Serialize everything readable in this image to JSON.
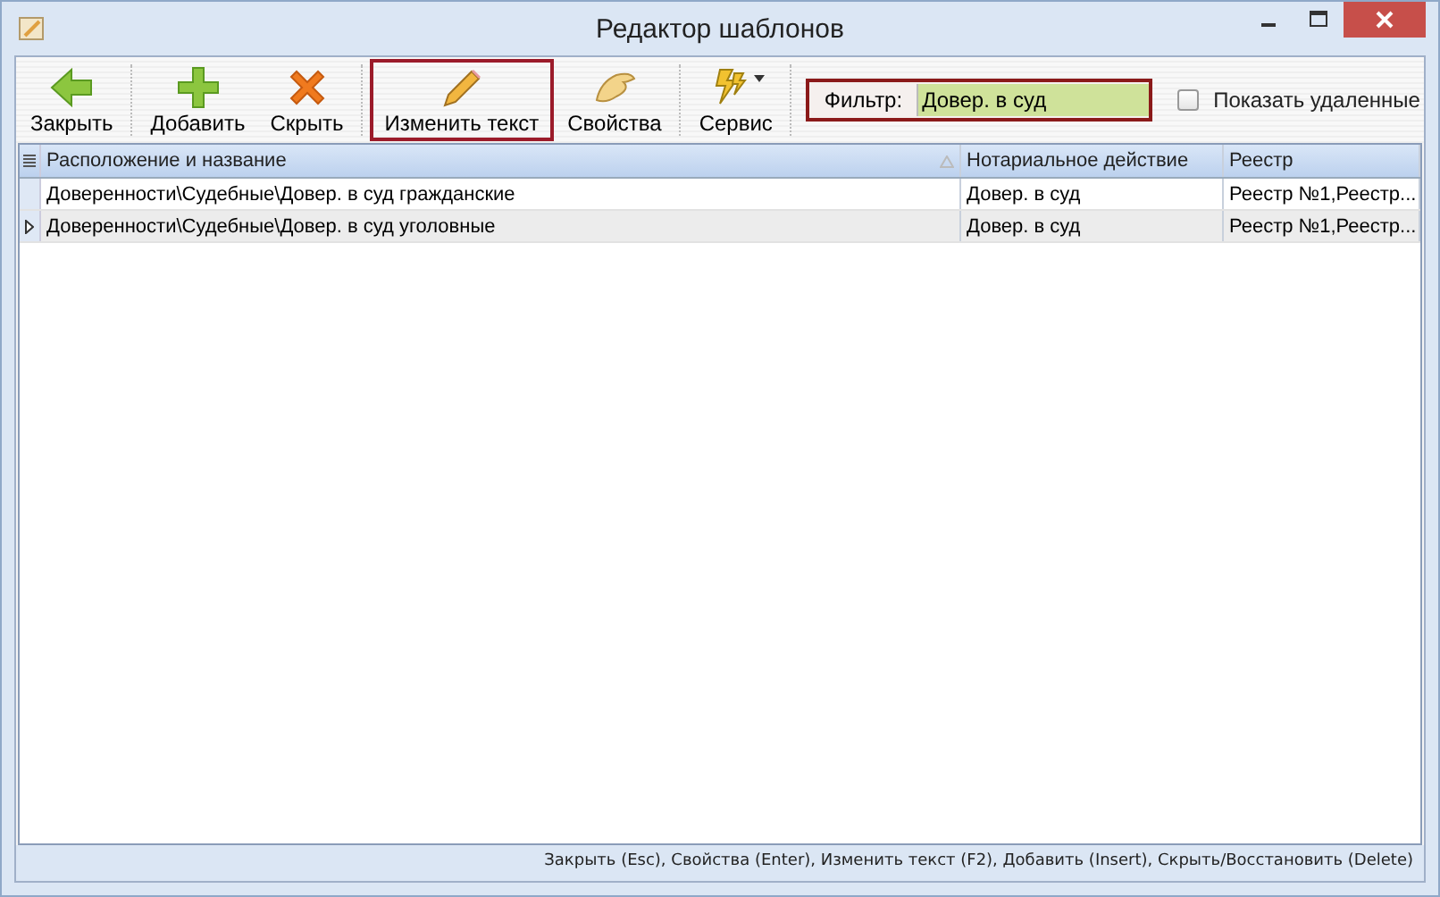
{
  "window": {
    "title": "Редактор шаблонов"
  },
  "toolbar": [
    {
      "kind": "back",
      "label": "Закрыть",
      "highlighted": false
    },
    {
      "kind": "add",
      "label": "Добавить",
      "highlighted": false
    },
    {
      "kind": "hide",
      "label": "Скрыть",
      "highlighted": false
    },
    {
      "kind": "edit",
      "label": "Изменить текст",
      "highlighted": true
    },
    {
      "kind": "props",
      "label": "Свойства",
      "highlighted": false
    },
    {
      "kind": "service",
      "label": "Сервис",
      "highlighted": false
    }
  ],
  "filter": {
    "label": "Фильтр:",
    "value": "Довер. в суд",
    "highlighted": true
  },
  "show_deleted": {
    "label": "Показать удаленные",
    "checked": false
  },
  "table": {
    "columns": [
      "Расположение и название",
      "Нотариальное действие",
      "Реестр"
    ],
    "rows": [
      {
        "cells": [
          "Доверенности\\Судебные\\Довер. в суд гражданские",
          "Довер. в суд",
          "Реестр №1,Реестр..."
        ],
        "selected": false
      },
      {
        "cells": [
          "Доверенности\\Судебные\\Довер. в суд уголовные",
          "Довер. в суд",
          "Реестр №1,Реестр..."
        ],
        "selected": true
      }
    ]
  },
  "status_bar": "Закрыть (Esc), Свойства (Enter), Изменить текст (F2), Добавить (Insert), Скрыть/Восстановить (Delete)"
}
